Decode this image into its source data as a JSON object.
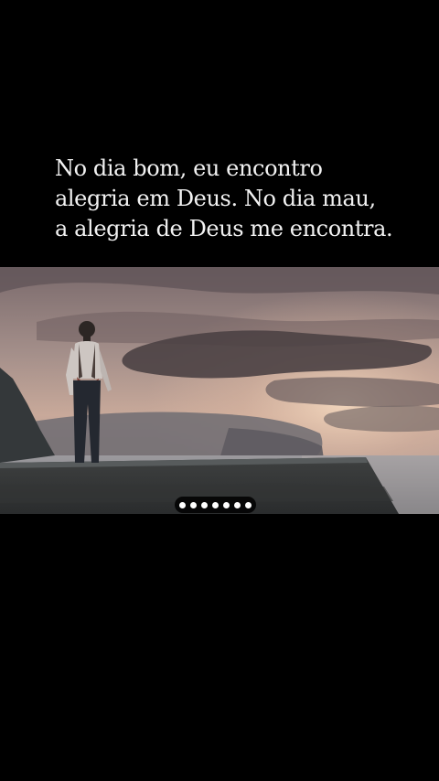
{
  "story": {
    "quote_lines": [
      "No dia bom, eu encontro",
      "alegria em Deus. No dia mau,",
      "a alegria de Deus me encontra."
    ],
    "pager": {
      "count": 7,
      "active": 0
    }
  }
}
